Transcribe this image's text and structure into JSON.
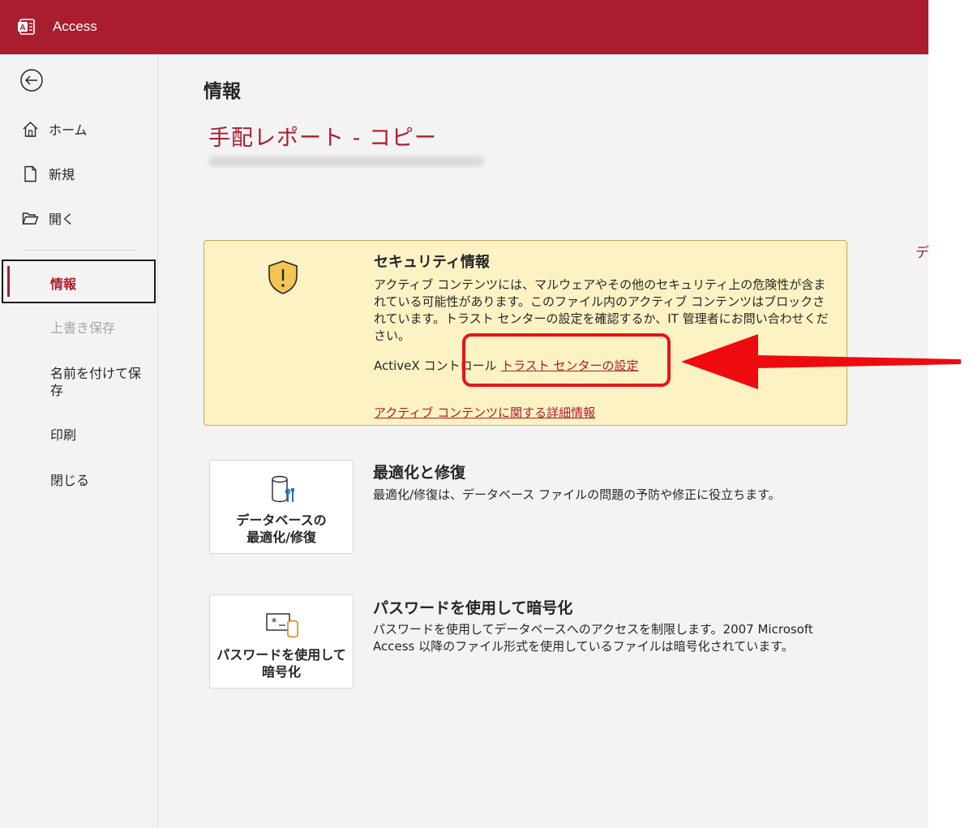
{
  "titlebar": {
    "app_name": "Access"
  },
  "sidebar": {
    "home": "ホーム",
    "new": "新規",
    "open": "開く",
    "info": "情報",
    "save": "上書き保存",
    "save_as": "名前を付けて保\n存",
    "print": "印刷",
    "close": "閉じる"
  },
  "main": {
    "heading": "情報",
    "file_title": "手配レポート - コピー",
    "edge_text": "デ"
  },
  "security": {
    "title": "セキュリティ情報",
    "description": "アクティブ コンテンツには、マルウェアやその他のセキュリティ上の危険性が含まれている可能性があります。このファイル内のアクティブ コンテンツはブロックされています。トラスト センターの設定を確認するか、IT 管理者にお問い合わせください。",
    "activex_label": "ActiveX コントロール",
    "trust_center_link": "トラスト センターの設定",
    "more_info_link": "アクティブ コンテンツに関する詳細情報"
  },
  "compact": {
    "tile_label": "データベースの\n最適化/修復",
    "title": "最適化と修復",
    "description": "最適化/修復は、データベース ファイルの問題の予防や修正に役立ちます。"
  },
  "encrypt": {
    "tile_label": "パスワードを使用して\n暗号化",
    "title": "パスワードを使用して暗号化",
    "description": "パスワードを使用してデータベースへのアクセスを制限します。2007 Microsoft Access 以降のファイル形式を使用しているファイルは暗号化されています。"
  },
  "colors": {
    "accent": "#a91d2f",
    "warning_bg": "#fdf2c3",
    "annotation_red": "#e8141a"
  },
  "icons": [
    "access-logo-icon",
    "back-arrow-icon",
    "home-icon",
    "new-file-icon",
    "open-folder-icon",
    "shield-warning-icon",
    "compact-database-icon",
    "encrypt-database-icon"
  ]
}
